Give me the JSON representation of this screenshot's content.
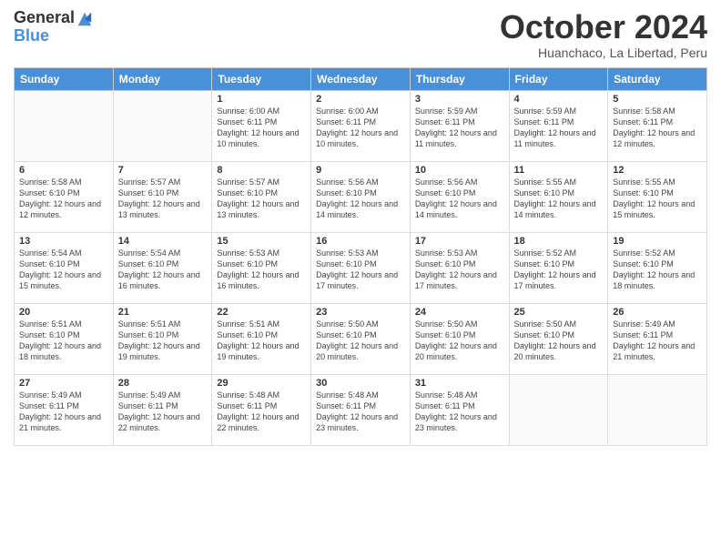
{
  "logo": {
    "general": "General",
    "blue": "Blue"
  },
  "title": "October 2024",
  "subtitle": "Huanchaco, La Libertad, Peru",
  "days_of_week": [
    "Sunday",
    "Monday",
    "Tuesday",
    "Wednesday",
    "Thursday",
    "Friday",
    "Saturday"
  ],
  "weeks": [
    [
      {
        "day": "",
        "info": ""
      },
      {
        "day": "",
        "info": ""
      },
      {
        "day": "1",
        "info": "Sunrise: 6:00 AM\nSunset: 6:11 PM\nDaylight: 12 hours\nand 10 minutes."
      },
      {
        "day": "2",
        "info": "Sunrise: 6:00 AM\nSunset: 6:11 PM\nDaylight: 12 hours\nand 10 minutes."
      },
      {
        "day": "3",
        "info": "Sunrise: 5:59 AM\nSunset: 6:11 PM\nDaylight: 12 hours\nand 11 minutes."
      },
      {
        "day": "4",
        "info": "Sunrise: 5:59 AM\nSunset: 6:11 PM\nDaylight: 12 hours\nand 11 minutes."
      },
      {
        "day": "5",
        "info": "Sunrise: 5:58 AM\nSunset: 6:11 PM\nDaylight: 12 hours\nand 12 minutes."
      }
    ],
    [
      {
        "day": "6",
        "info": "Sunrise: 5:58 AM\nSunset: 6:10 PM\nDaylight: 12 hours\nand 12 minutes."
      },
      {
        "day": "7",
        "info": "Sunrise: 5:57 AM\nSunset: 6:10 PM\nDaylight: 12 hours\nand 13 minutes."
      },
      {
        "day": "8",
        "info": "Sunrise: 5:57 AM\nSunset: 6:10 PM\nDaylight: 12 hours\nand 13 minutes."
      },
      {
        "day": "9",
        "info": "Sunrise: 5:56 AM\nSunset: 6:10 PM\nDaylight: 12 hours\nand 14 minutes."
      },
      {
        "day": "10",
        "info": "Sunrise: 5:56 AM\nSunset: 6:10 PM\nDaylight: 12 hours\nand 14 minutes."
      },
      {
        "day": "11",
        "info": "Sunrise: 5:55 AM\nSunset: 6:10 PM\nDaylight: 12 hours\nand 14 minutes."
      },
      {
        "day": "12",
        "info": "Sunrise: 5:55 AM\nSunset: 6:10 PM\nDaylight: 12 hours\nand 15 minutes."
      }
    ],
    [
      {
        "day": "13",
        "info": "Sunrise: 5:54 AM\nSunset: 6:10 PM\nDaylight: 12 hours\nand 15 minutes."
      },
      {
        "day": "14",
        "info": "Sunrise: 5:54 AM\nSunset: 6:10 PM\nDaylight: 12 hours\nand 16 minutes."
      },
      {
        "day": "15",
        "info": "Sunrise: 5:53 AM\nSunset: 6:10 PM\nDaylight: 12 hours\nand 16 minutes."
      },
      {
        "day": "16",
        "info": "Sunrise: 5:53 AM\nSunset: 6:10 PM\nDaylight: 12 hours\nand 17 minutes."
      },
      {
        "day": "17",
        "info": "Sunrise: 5:53 AM\nSunset: 6:10 PM\nDaylight: 12 hours\nand 17 minutes."
      },
      {
        "day": "18",
        "info": "Sunrise: 5:52 AM\nSunset: 6:10 PM\nDaylight: 12 hours\nand 17 minutes."
      },
      {
        "day": "19",
        "info": "Sunrise: 5:52 AM\nSunset: 6:10 PM\nDaylight: 12 hours\nand 18 minutes."
      }
    ],
    [
      {
        "day": "20",
        "info": "Sunrise: 5:51 AM\nSunset: 6:10 PM\nDaylight: 12 hours\nand 18 minutes."
      },
      {
        "day": "21",
        "info": "Sunrise: 5:51 AM\nSunset: 6:10 PM\nDaylight: 12 hours\nand 19 minutes."
      },
      {
        "day": "22",
        "info": "Sunrise: 5:51 AM\nSunset: 6:10 PM\nDaylight: 12 hours\nand 19 minutes."
      },
      {
        "day": "23",
        "info": "Sunrise: 5:50 AM\nSunset: 6:10 PM\nDaylight: 12 hours\nand 20 minutes."
      },
      {
        "day": "24",
        "info": "Sunrise: 5:50 AM\nSunset: 6:10 PM\nDaylight: 12 hours\nand 20 minutes."
      },
      {
        "day": "25",
        "info": "Sunrise: 5:50 AM\nSunset: 6:10 PM\nDaylight: 12 hours\nand 20 minutes."
      },
      {
        "day": "26",
        "info": "Sunrise: 5:49 AM\nSunset: 6:11 PM\nDaylight: 12 hours\nand 21 minutes."
      }
    ],
    [
      {
        "day": "27",
        "info": "Sunrise: 5:49 AM\nSunset: 6:11 PM\nDaylight: 12 hours\nand 21 minutes."
      },
      {
        "day": "28",
        "info": "Sunrise: 5:49 AM\nSunset: 6:11 PM\nDaylight: 12 hours\nand 22 minutes."
      },
      {
        "day": "29",
        "info": "Sunrise: 5:48 AM\nSunset: 6:11 PM\nDaylight: 12 hours\nand 22 minutes."
      },
      {
        "day": "30",
        "info": "Sunrise: 5:48 AM\nSunset: 6:11 PM\nDaylight: 12 hours\nand 23 minutes."
      },
      {
        "day": "31",
        "info": "Sunrise: 5:48 AM\nSunset: 6:11 PM\nDaylight: 12 hours\nand 23 minutes."
      },
      {
        "day": "",
        "info": ""
      },
      {
        "day": "",
        "info": ""
      }
    ]
  ]
}
